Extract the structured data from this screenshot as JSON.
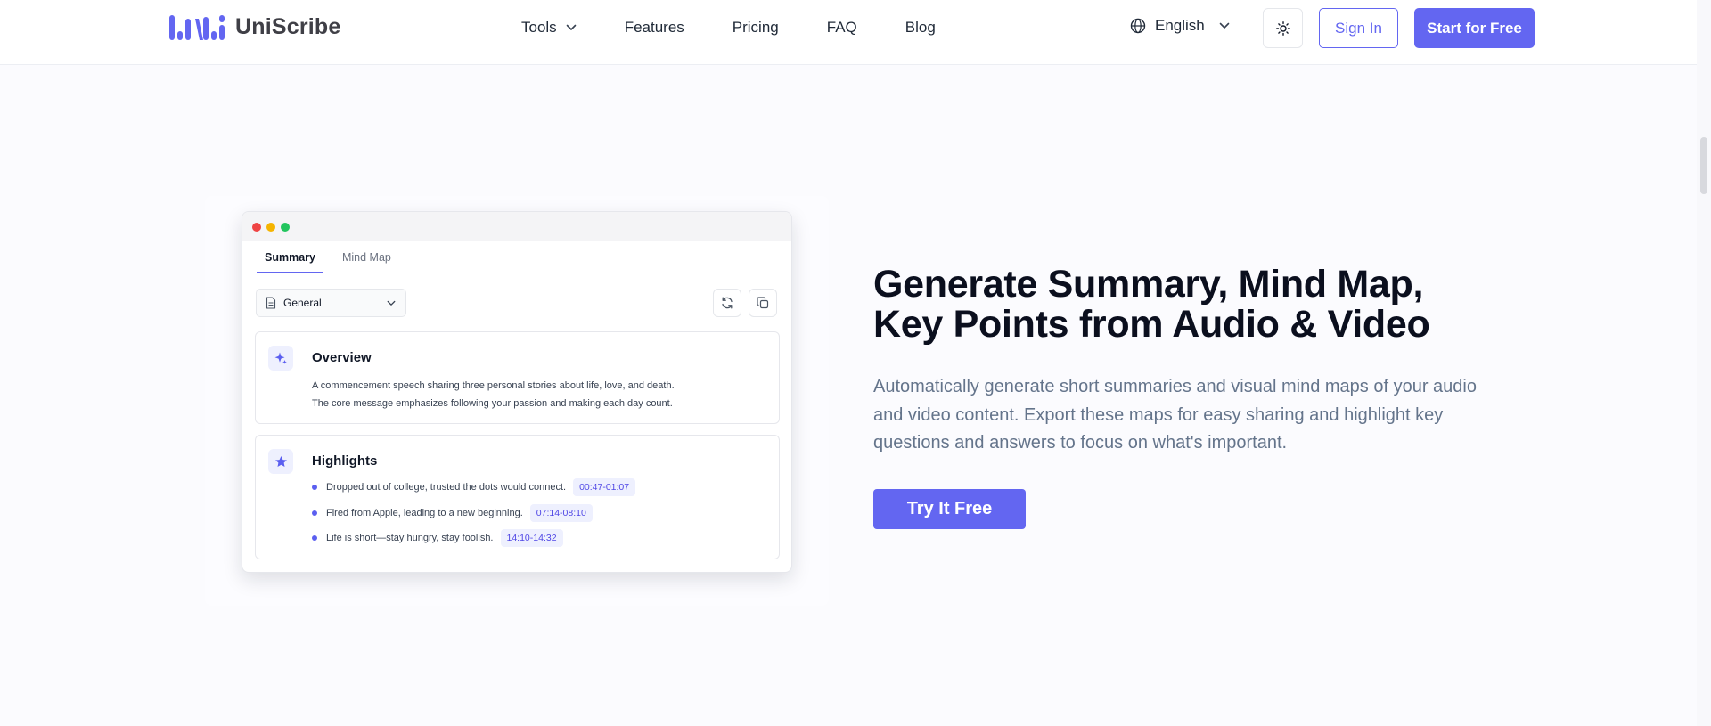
{
  "header": {
    "brand": "UniScribe",
    "nav": [
      {
        "label": "Tools",
        "has_dropdown": true
      },
      {
        "label": "Features"
      },
      {
        "label": "Pricing"
      },
      {
        "label": "FAQ"
      },
      {
        "label": "Blog"
      }
    ],
    "language": "English",
    "sign_in": "Sign In",
    "start_free": "Start for Free"
  },
  "mockup": {
    "tabs": [
      {
        "label": "Summary",
        "active": true
      },
      {
        "label": "Mind Map",
        "active": false
      }
    ],
    "select_value": "General",
    "overview": {
      "title": "Overview",
      "lines": [
        "A commencement speech sharing three personal stories about life, love, and death.",
        "The core message emphasizes following your passion and making each day count."
      ]
    },
    "highlights": {
      "title": "Highlights",
      "items": [
        {
          "text": "Dropped out of college, trusted the dots would connect.",
          "time": "00:47-01:07"
        },
        {
          "text": "Fired from Apple, leading to a new beginning.",
          "time": "07:14-08:10"
        },
        {
          "text": "Life is short—stay hungry, stay foolish.",
          "time": "14:10-14:32"
        }
      ]
    }
  },
  "hero": {
    "title_line1": "Generate Summary, Mind Map,",
    "title_line2": "Key Points from Audio & Video",
    "description": "Automatically generate short summaries and visual mind maps of your audio and video content. Export these maps for easy sharing and highlight key questions and answers to focus on what's important.",
    "cta": "Try It Free"
  },
  "colors": {
    "accent": "#6366f1",
    "dot_red": "#ef4444",
    "dot_yellow": "#f5b400",
    "dot_green": "#22c55e"
  }
}
